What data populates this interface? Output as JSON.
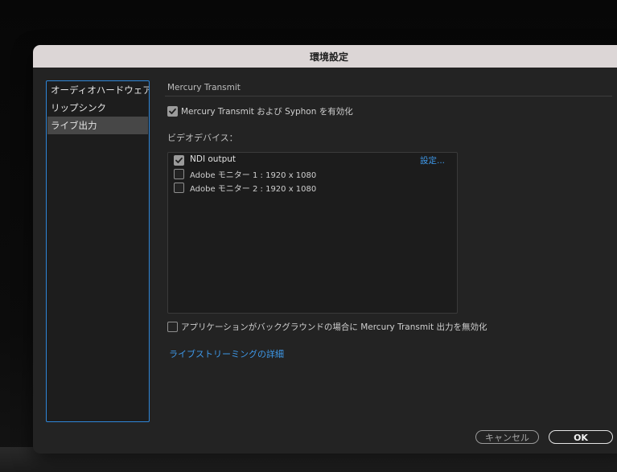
{
  "window": {
    "title": "環境設定"
  },
  "sidebar": {
    "items": [
      {
        "label": "オーディオハードウェア",
        "selected": false
      },
      {
        "label": "リップシンク",
        "selected": false
      },
      {
        "label": "ライブ出力",
        "selected": true
      }
    ]
  },
  "main": {
    "section_title": "Mercury Transmit",
    "enable_checkbox": {
      "label": "Mercury Transmit および Syphon を有効化",
      "checked": true
    },
    "video_devices_label": "ビデオデバイス：",
    "settings_link": "設定...",
    "devices": [
      {
        "label": "NDI output",
        "checked": true
      },
      {
        "label": "Adobe モニター 1 : 1920 x 1080",
        "checked": false
      },
      {
        "label": "Adobe モニター 2 : 1920 x 1080",
        "checked": false
      }
    ],
    "background_checkbox": {
      "label": "アプリケーションがバックグラウンドの場合に Mercury Transmit 出力を無効化",
      "checked": false
    },
    "live_streaming_link": "ライブストリーミングの詳細"
  },
  "footer": {
    "cancel_label": "キャンセル",
    "ok_label": "OK"
  },
  "colors": {
    "accent_border": "#2f86d8",
    "link": "#3e98e8",
    "panel_bg": "#232323",
    "titlebar_bg": "#dcd6d6",
    "selected_item_bg": "#474747"
  },
  "icons": {
    "checkmark": "check-icon"
  }
}
